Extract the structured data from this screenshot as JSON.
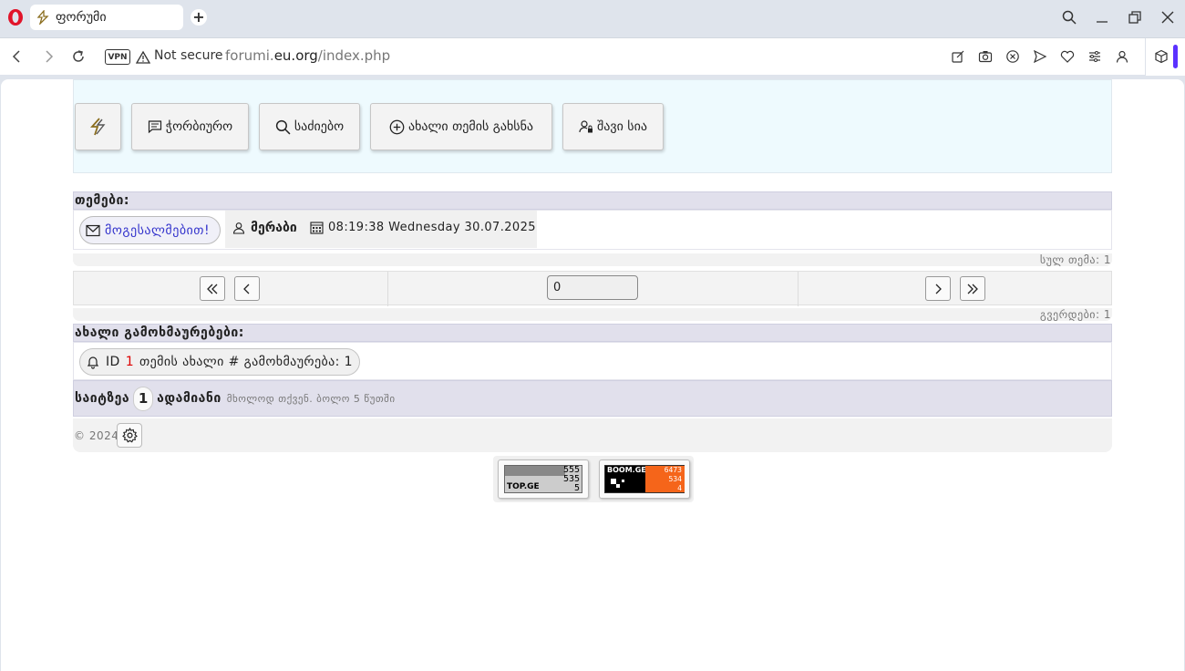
{
  "browser": {
    "tab_title": "ფორუმი",
    "new_tab_symbol": "+",
    "vpn_label": "VPN",
    "security_label": "Not secure",
    "url_prefix": "forumi.",
    "url_host": "eu.org",
    "url_path": "/index.php"
  },
  "header": {
    "buttons": [
      {
        "label": "",
        "icon": "forum-logo-icon"
      },
      {
        "label": "ჭორბიურო",
        "icon": "chat-icon"
      },
      {
        "label": "საძიებო",
        "icon": "search-icon"
      },
      {
        "label": "ახალი თემის გახსნა",
        "icon": "plus-circle-icon"
      },
      {
        "label": "შავი სია",
        "icon": "user-lock-icon"
      }
    ]
  },
  "topics": {
    "heading": "თემები:",
    "items": [
      {
        "title": "მოგესალმებით!",
        "author": "მერაბი",
        "datetime": "08:19:38 Wednesday 30.07.2025"
      }
    ],
    "total_label": "სულ თემა: 1"
  },
  "pagination": {
    "page_value": "0",
    "pages_label": "გვერდები: 1"
  },
  "replies": {
    "heading": "ახალი გამოხმაურებები:",
    "item_prefix": "ID",
    "item_id": "1",
    "item_text": "თემის ახალი # გამოხმაურება: 1"
  },
  "online": {
    "label_before": "საიტზეა",
    "count": "1",
    "label_after": "ადამიანი",
    "note": "მხოლოდ თქვენ. ბოლო 5 წუთში"
  },
  "footer": {
    "copyright": "© 2024"
  },
  "counters": {
    "topge": {
      "brand": "TOP.GE",
      "values": [
        "555",
        "535",
        "5"
      ]
    },
    "boomge": {
      "brand": "BOOM.GE",
      "values": [
        "6473",
        "534",
        "4"
      ]
    }
  },
  "colors": {
    "header_bg": "#eefafe",
    "section_bg": "#e1e0ec",
    "link": "#3333cc",
    "accent_red": "#dd0000",
    "opera_red": "#e1142a",
    "boom_orange": "#f5651a"
  }
}
